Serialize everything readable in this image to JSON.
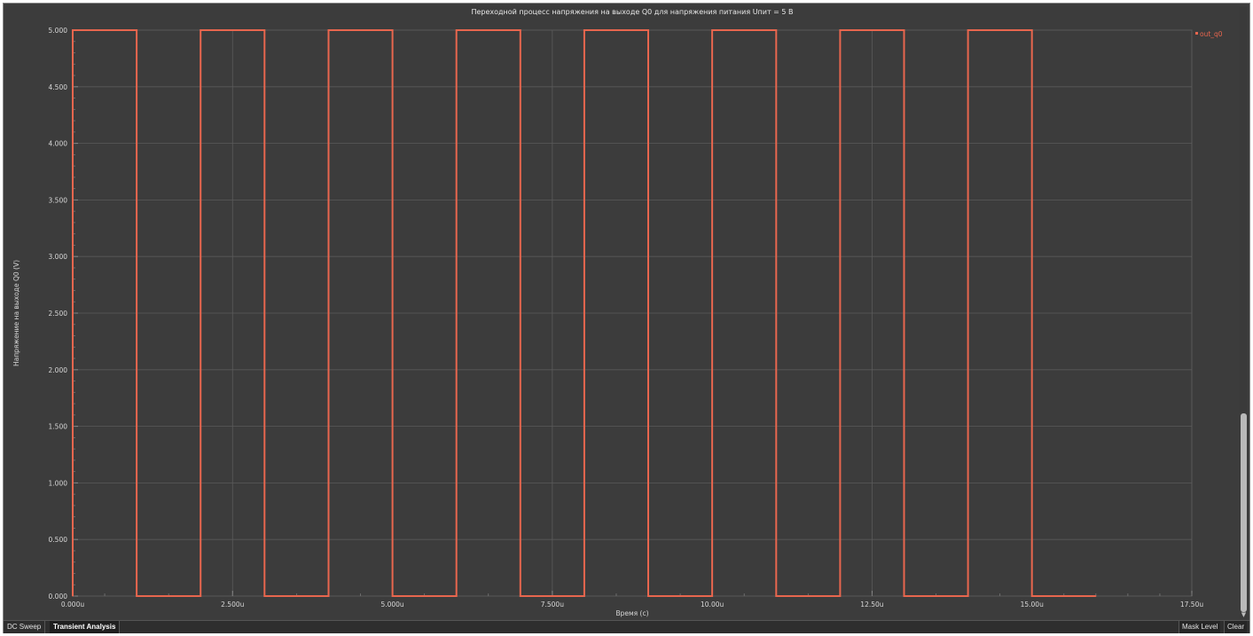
{
  "chart_data": {
    "type": "line",
    "title": "Переходной процесс напряжения на выходе Q0 для напряжения питания Uпит = 5 В",
    "xlabel": "Время (c)",
    "ylabel": "Напряжение на выходе Q0 (V)",
    "xlim": [
      0,
      17.5
    ],
    "ylim": [
      0,
      5
    ],
    "x_unit": "u",
    "x_ticks": [
      0,
      2.5,
      5,
      7.5,
      10,
      12.5,
      15,
      17.5
    ],
    "x_tick_labels": [
      "0.000u",
      "2.500u",
      "5.000u",
      "7.500u",
      "10.00u",
      "12.50u",
      "15.00u",
      "17.50u"
    ],
    "y_ticks": [
      0,
      0.5,
      1,
      1.5,
      2,
      2.5,
      3,
      3.5,
      4,
      4.5,
      5
    ],
    "y_tick_labels": [
      "0.000",
      "0.500",
      "1.000",
      "1.500",
      "2.000",
      "2.500",
      "3.000",
      "3.500",
      "4.000",
      "4.500",
      "5.000"
    ],
    "grid": true,
    "legend_position": "top-right",
    "series": [
      {
        "name": "out_q0",
        "color": "#e8664e",
        "x": [
          0,
          0,
          1,
          1,
          2,
          2,
          3,
          3,
          4,
          4,
          5,
          5,
          6,
          6,
          7,
          7,
          8,
          8,
          9,
          9,
          10,
          10,
          11,
          11,
          12,
          12,
          13,
          13,
          14,
          14,
          15,
          15,
          16
        ],
        "y": [
          0,
          5,
          5,
          0,
          0,
          5,
          5,
          0,
          0,
          5,
          5,
          0,
          0,
          5,
          5,
          0,
          0,
          5,
          5,
          0,
          0,
          5,
          5,
          0,
          0,
          5,
          5,
          0,
          0,
          5,
          5,
          0,
          0
        ]
      }
    ]
  },
  "tabs": [
    "DC Sweep",
    "Transient Analysis"
  ],
  "active_tab": "Transient Analysis",
  "tools": {
    "mask_level": "Mask Level",
    "clear": "Clear"
  },
  "colors": {
    "background": "#3c3c3c",
    "grid": "#5a5a5a",
    "series": "#e8664e"
  }
}
